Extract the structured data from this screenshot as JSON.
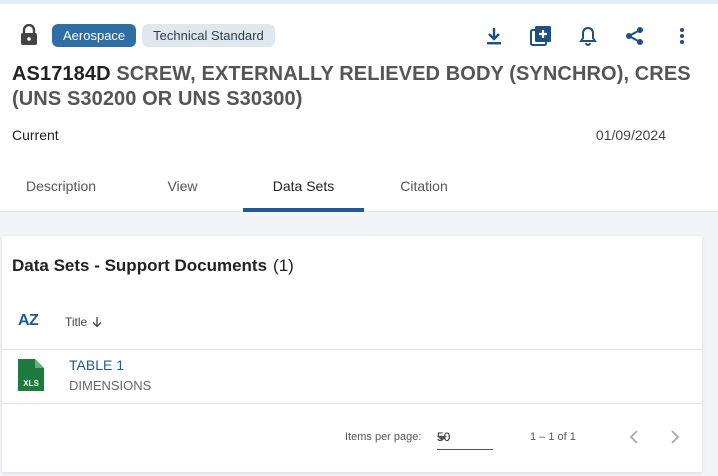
{
  "header": {
    "badges": [
      "Aerospace",
      "Technical Standard"
    ],
    "actions": [
      "download-icon",
      "add-to-library-icon",
      "bell-icon",
      "share-icon",
      "more-vertical-icon"
    ],
    "title_code": "AS17184D",
    "title_rest": " SCREW, EXTERNALLY RELIEVED BODY (SYNCHRO), CRES (UNS S30200 OR UNS S30300)",
    "status": "Current",
    "date": "01/09/2024"
  },
  "tabs": [
    {
      "label": "Description",
      "active": false
    },
    {
      "label": "View",
      "active": false
    },
    {
      "label": "Data Sets",
      "active": true
    },
    {
      "label": "Citation",
      "active": false
    }
  ],
  "datasets": {
    "section_title": "Data Sets - Support Documents",
    "count": "(1)",
    "sort_icon_text": "AZ",
    "sort_label": "Title",
    "items": [
      {
        "title": "TABLE 1",
        "subtitle": "DIMENSIONS",
        "file_type": "XLS"
      }
    ]
  },
  "pager": {
    "items_per_page_label": "Items per page:",
    "items_per_page_value": "50",
    "range": "1 – 1 of 1"
  },
  "colors": {
    "accent": "#1f5a96",
    "badge_primary": "#2f6ea5",
    "badge_secondary": "#dfe7ef",
    "xls_green": "#1e7a3f"
  }
}
